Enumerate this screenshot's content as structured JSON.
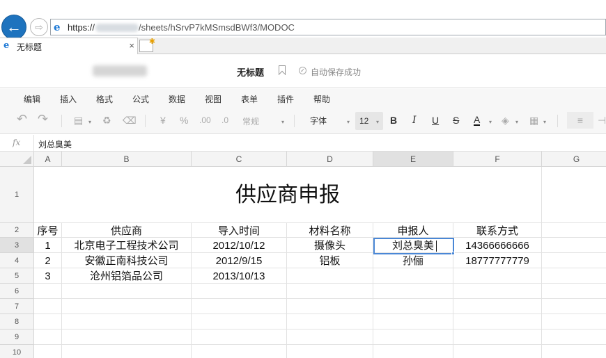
{
  "browser": {
    "url_scheme": "https://",
    "url_path": "/sheets/hSrvP7kMSmsdBWf3/MODOC",
    "tab_title": "无标题",
    "tab_close": "×"
  },
  "doc": {
    "title": "无标题",
    "save_status": "自动保存成功"
  },
  "menu": [
    "编辑",
    "插入",
    "格式",
    "公式",
    "数据",
    "视图",
    "表单",
    "插件",
    "帮助"
  ],
  "toolbar": {
    "undo": "↶",
    "redo": "↷",
    "currency": "¥",
    "percent": "%",
    "dec_inc": ".00",
    "dec_dec": ".0",
    "number_format": "常规",
    "font": "字体",
    "font_size": "12",
    "bold": "B",
    "italic": "I",
    "underline": "U",
    "strike": "S",
    "font_color": "A"
  },
  "formula_bar": {
    "fx": "fx",
    "value": "刘总臭美"
  },
  "sheet": {
    "columns": [
      "A",
      "B",
      "C",
      "D",
      "E",
      "F",
      "G"
    ],
    "rows": [
      "1",
      "2",
      "3",
      "4",
      "5",
      "6",
      "7",
      "8",
      "9",
      "10"
    ],
    "title": "供应商申报",
    "header": [
      "序号",
      "供应商",
      "导入时间",
      "材料名称",
      "申报人",
      "联系方式"
    ],
    "data": [
      [
        "1",
        "北京电子工程技术公司",
        "2012/10/12",
        "摄像头",
        "刘总臭美",
        "14366666666"
      ],
      [
        "2",
        "安徽正南科技公司",
        "2012/9/15",
        "铝板",
        "孙俪",
        "18777777779"
      ],
      [
        "3",
        "沧州铝箔品公司",
        "2013/10/13",
        "",
        "",
        ""
      ]
    ],
    "active_cell": "E3"
  }
}
